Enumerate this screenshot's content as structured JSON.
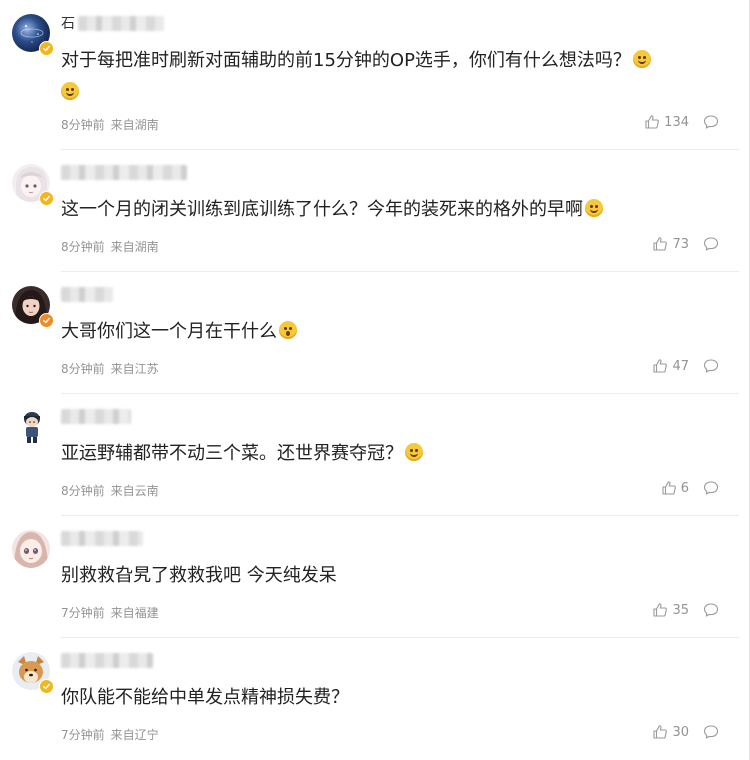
{
  "comments": [
    {
      "username_visible": "石",
      "text": "对于每把准时刷新对面辅助的前15分钟的OP选手，你们有什么想法吗？",
      "time": "8分钟前",
      "location": "来自湖南",
      "likes": "134",
      "avatar_icon": "galaxy-avatar-icon",
      "badge": "gold"
    },
    {
      "username_visible": "",
      "text": "这一个月的闭关训练到底训练了什么？今年的装死来的格外的早啊",
      "time": "8分钟前",
      "location": "来自湖南",
      "likes": "73",
      "avatar_icon": "anime-avatar-icon",
      "badge": "gold"
    },
    {
      "username_visible": "",
      "text": "大哥你们这一个月在干什么",
      "time": "8分钟前",
      "location": "来自江苏",
      "likes": "47",
      "avatar_icon": "girl-avatar-icon",
      "badge": "orange"
    },
    {
      "username_visible": "",
      "text": "亚运野辅都带不动三个菜。还世界赛夺冠？",
      "time": "8分钟前",
      "location": "来自云南",
      "likes": "6",
      "avatar_icon": "cartoon-avatar-icon",
      "badge": ""
    },
    {
      "username_visible": "",
      "text": "别救救旮旯了救救我吧 今天纯发呆",
      "time": "7分钟前",
      "location": "来自福建",
      "likes": "35",
      "avatar_icon": "doll-avatar-icon",
      "badge": ""
    },
    {
      "username_visible": "",
      "text": "你队能不能给中单发点精神损失费？",
      "time": "7分钟前",
      "location": "来自辽宁",
      "likes": "30",
      "avatar_icon": "dog-avatar-icon",
      "badge": "gold"
    }
  ],
  "colors": {
    "text": "#222222",
    "meta": "#939393",
    "separator": "#ececec",
    "badge_gold": "#f3b61c",
    "badge_orange": "#f08a24"
  }
}
